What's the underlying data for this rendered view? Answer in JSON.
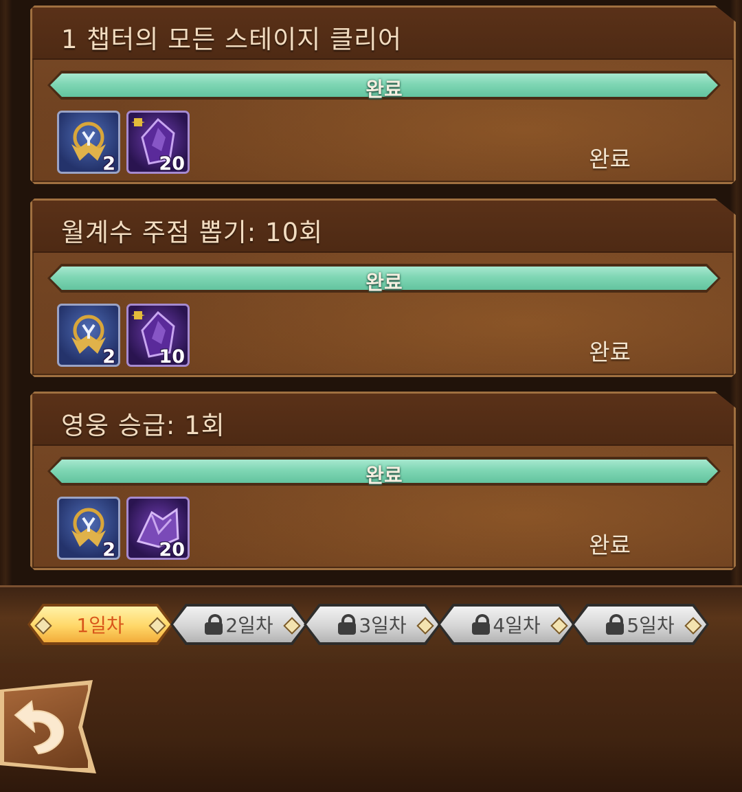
{
  "quests": [
    {
      "title": "1 챕터의 모든 스테이지 클리어",
      "progress_label": "완료",
      "progress": 1.0,
      "rewards": [
        {
          "icon": "guild-badge-icon",
          "count": "2"
        },
        {
          "icon": "crystal-shard-icon",
          "count": "20"
        }
      ],
      "status": "완료"
    },
    {
      "title": "월계수 주점 뽑기: 10회",
      "progress_label": "완료",
      "progress": 1.0,
      "rewards": [
        {
          "icon": "guild-badge-icon",
          "count": "2"
        },
        {
          "icon": "crystal-shard-icon",
          "count": "10"
        }
      ],
      "status": "완료"
    },
    {
      "title": "영웅 승급: 1회",
      "progress_label": "완료",
      "progress": 1.0,
      "rewards": [
        {
          "icon": "guild-badge-icon",
          "count": "2"
        },
        {
          "icon": "purple-ore-icon",
          "count": "20"
        }
      ],
      "status": "완료"
    }
  ],
  "day_tabs": [
    {
      "label": "1일차",
      "locked": false,
      "active": true
    },
    {
      "label": "2일차",
      "locked": true,
      "active": false
    },
    {
      "label": "3일차",
      "locked": true,
      "active": false
    },
    {
      "label": "4일차",
      "locked": true,
      "active": false
    },
    {
      "label": "5일차",
      "locked": true,
      "active": false
    }
  ],
  "colors": {
    "progress_fill": "#7fd6b4",
    "active_tab": "#ffd768",
    "locked_tab": "#d5d5d5",
    "card_bg": "#6f4222"
  }
}
